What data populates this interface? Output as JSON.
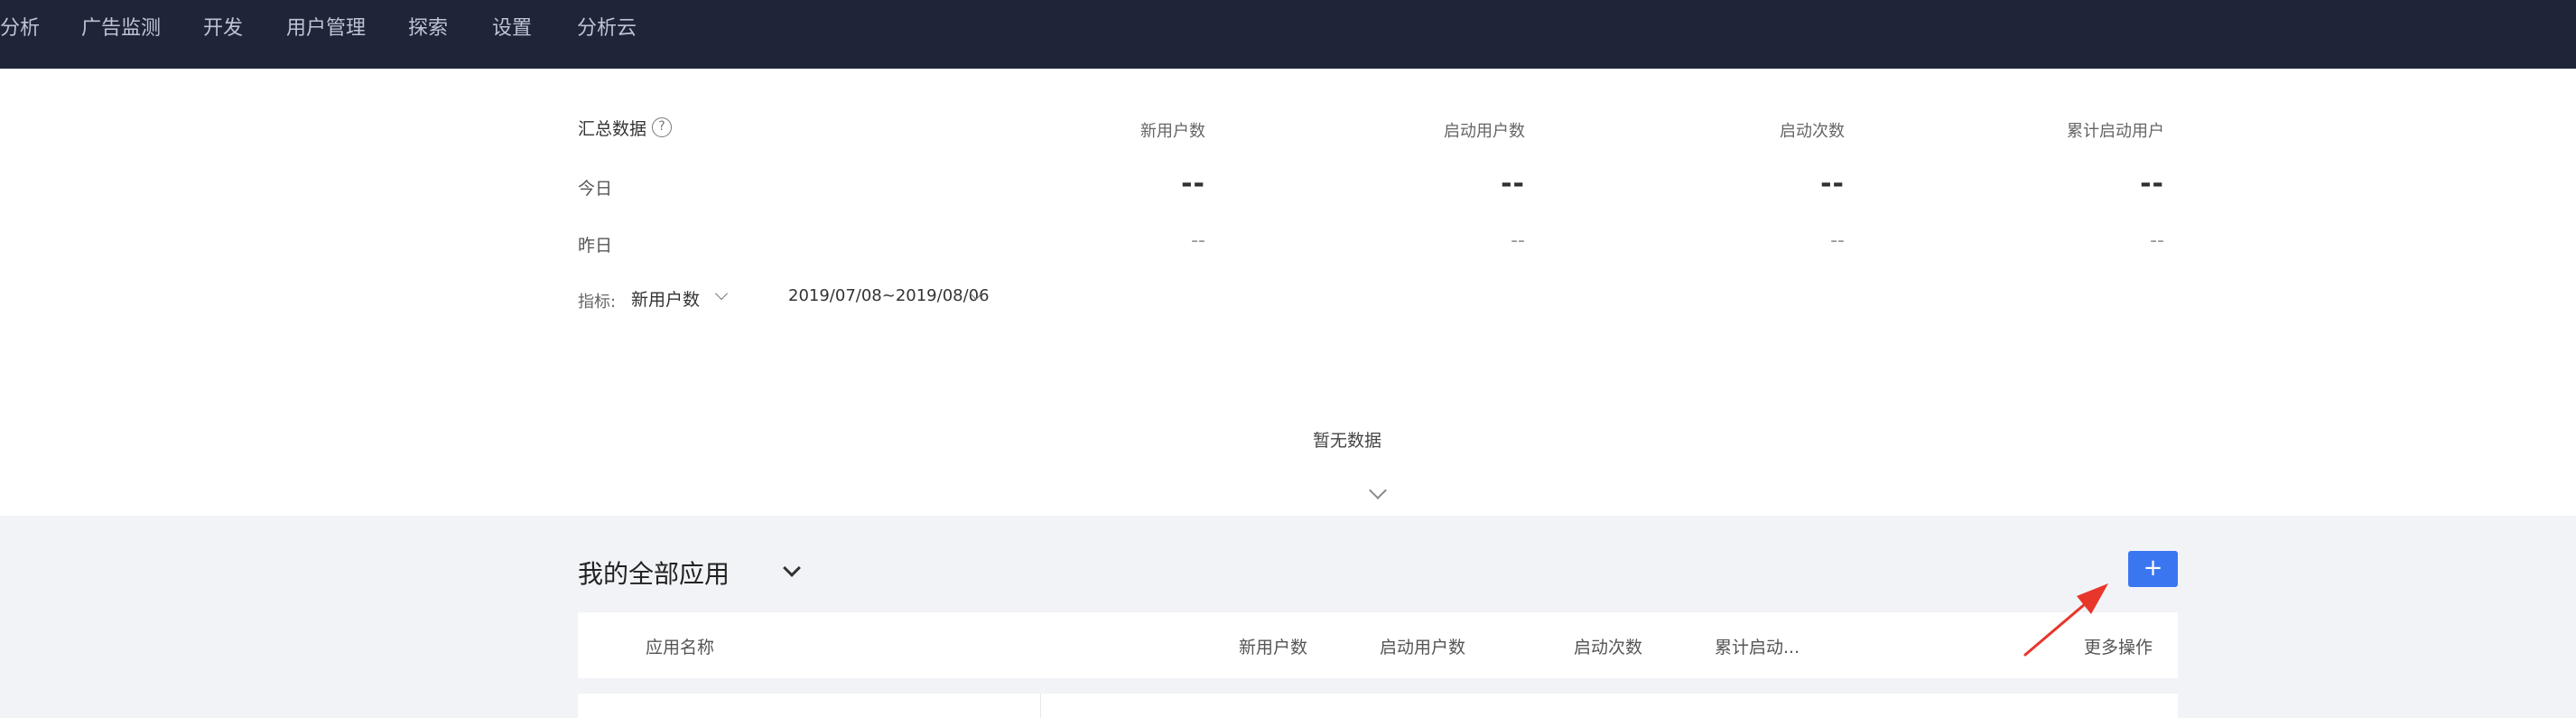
{
  "nav": {
    "items": [
      "分析",
      "广告监测",
      "开发",
      "用户管理",
      "探索",
      "设置",
      "分析云"
    ]
  },
  "summary": {
    "title": "汇总数据",
    "help_icon": "help-icon",
    "columns": [
      "新用户数",
      "启动用户数",
      "启动次数",
      "累计启动用户"
    ],
    "rows": [
      {
        "label": "今日",
        "values": [
          "--",
          "--",
          "--",
          "--"
        ]
      },
      {
        "label": "昨日",
        "values": [
          "--",
          "--",
          "--",
          "--"
        ]
      }
    ],
    "metric_label": "指标:",
    "metric_value": "新用户数",
    "date_range": "2019/07/08~2019/08/06",
    "empty_text": "暂无数据"
  },
  "apps": {
    "title": "我的全部应用",
    "add_label": "+",
    "table_headers": {
      "name": "应用名称",
      "new_users": "新用户数",
      "active_users": "启动用户数",
      "launches": "启动次数",
      "cumulative": "累计启动...",
      "more": "更多操作"
    }
  },
  "colors": {
    "nav_bg": "#1e2539",
    "accent": "#3b76f1",
    "annotation": "#e8362b"
  }
}
